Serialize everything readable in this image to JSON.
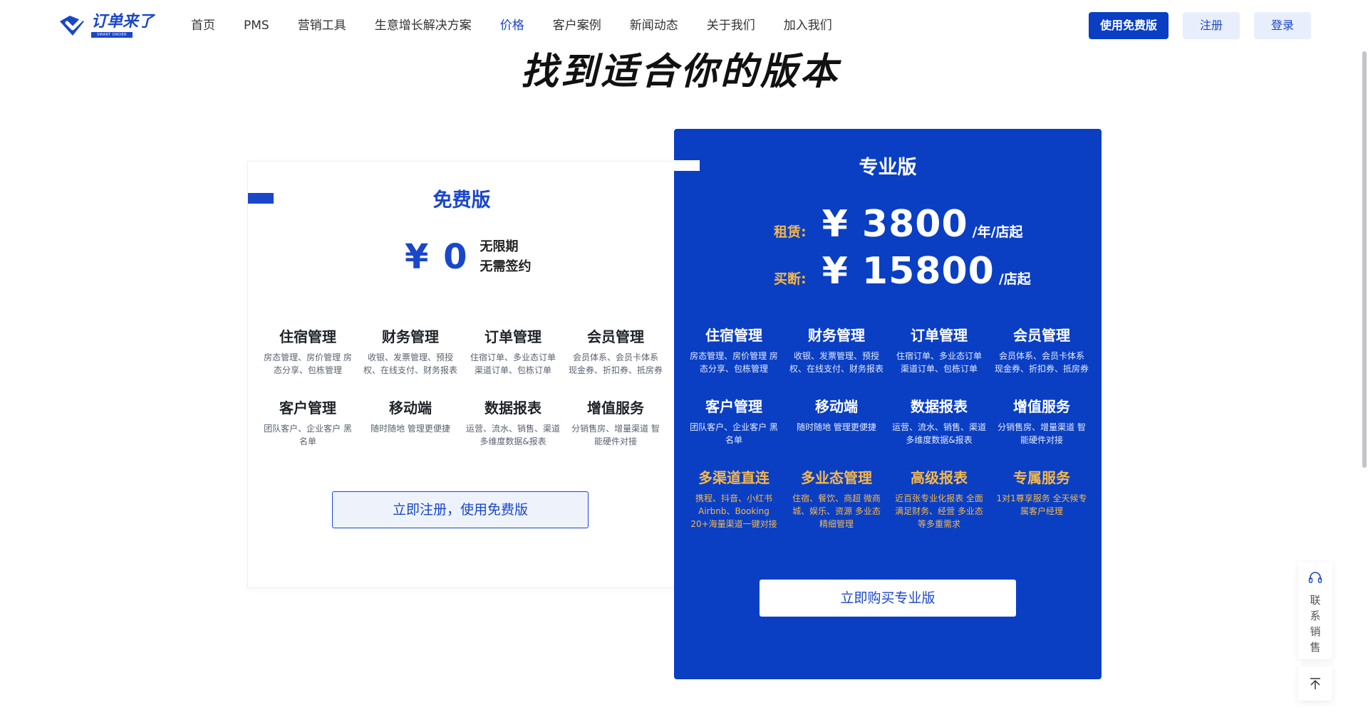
{
  "brand": {
    "name": "订单来了",
    "subtitle": "SMART ORDER",
    "color": "#1a47c9"
  },
  "nav": {
    "items": [
      {
        "label": "首页"
      },
      {
        "label": "PMS"
      },
      {
        "label": "营销工具"
      },
      {
        "label": "生意增长解决方案"
      },
      {
        "label": "价格",
        "active": true
      },
      {
        "label": "客户案例"
      },
      {
        "label": "新闻动态"
      },
      {
        "label": "关于我们"
      },
      {
        "label": "加入我们"
      }
    ]
  },
  "header_buttons": {
    "free": "使用免费版",
    "register": "注册",
    "login": "登录"
  },
  "page_title": "找到适合你的版本",
  "free_plan": {
    "title": "免费版",
    "price": "¥ 0",
    "terms": [
      "无限期",
      "无需签约"
    ],
    "features": [
      {
        "name": "住宿管理",
        "desc": "房态管理、房价管理 房态分享、包栋管理"
      },
      {
        "name": "财务管理",
        "desc": "收银、发票管理、预授权、在线支付、财务报表"
      },
      {
        "name": "订单管理",
        "desc": "住宿订单、多业态订单 渠道订单、包栋订单"
      },
      {
        "name": "会员管理",
        "desc": "会员体系、会员卡体系 现金券、折扣券、抵房券"
      },
      {
        "name": "客户管理",
        "desc": "团队客户、企业客户 黑名单"
      },
      {
        "name": "移动端",
        "desc": "随时随地 管理更便捷"
      },
      {
        "name": "数据报表",
        "desc": "运营、流水、销售、渠道 多维度数据&报表"
      },
      {
        "name": "增值服务",
        "desc": "分销售房、增量渠道 智能硬件对接"
      }
    ],
    "cta": "立即注册，使用免费版"
  },
  "pro_plan": {
    "title": "专业版",
    "rent": {
      "label": "租赁:",
      "amount": "¥ 3800",
      "unit": "/年/店起"
    },
    "buyout": {
      "label": "买断:",
      "amount": "¥ 15800",
      "unit": "/店起"
    },
    "features": [
      {
        "name": "住宿管理",
        "desc": "房态管理、房价管理 房态分享、包栋管理"
      },
      {
        "name": "财务管理",
        "desc": "收银、发票管理、预授权、在线支付、财务报表"
      },
      {
        "name": "订单管理",
        "desc": "住宿订单、多业态订单 渠道订单、包栋订单"
      },
      {
        "name": "会员管理",
        "desc": "会员体系、会员卡体系 现金券、折扣券、抵房券"
      },
      {
        "name": "客户管理",
        "desc": "团队客户、企业客户 黑名单"
      },
      {
        "name": "移动端",
        "desc": "随时随地 管理更便捷"
      },
      {
        "name": "数据报表",
        "desc": "运营、流水、销售、渠道 多维度数据&报表"
      },
      {
        "name": "增值服务",
        "desc": "分销售房、增量渠道 智能硬件对接"
      }
    ],
    "advanced_features": [
      {
        "name": "多渠道直连",
        "desc": "携程、抖音、小红书 Airbnb、Booking 20+海量渠道一键对接"
      },
      {
        "name": "多业态管理",
        "desc": "住宿、餐饮、商超 微商城、娱乐、资源 多业态精细管理"
      },
      {
        "name": "高级报表",
        "desc": "近百张专业化报表 全面满足财务、经营 多业态等多重需求"
      },
      {
        "name": "专属服务",
        "desc": "1对1尊享服务 全天候专属客户经理"
      }
    ],
    "cta": "立即购买专业版"
  },
  "float": {
    "contact_label": "联系销售",
    "contact_icon": "headset-icon",
    "top_icon": "arrow-up-icon"
  },
  "colors": {
    "primary": "#0a3fc4",
    "accent_gold": "#f5b74a"
  }
}
